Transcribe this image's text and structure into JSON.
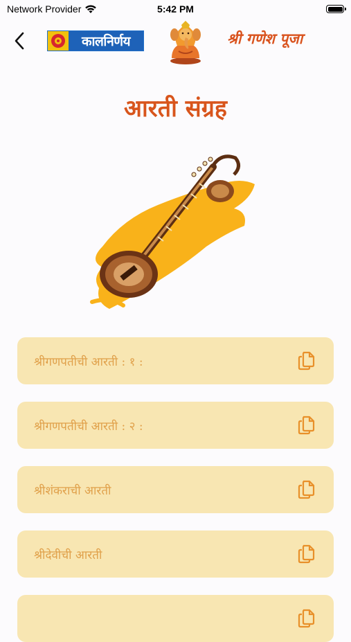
{
  "status_bar": {
    "carrier": "Network Provider",
    "time": "5:42 PM"
  },
  "header": {
    "logo_text": "कालनिर्णय",
    "page_name": "श्री गणेश पूजा"
  },
  "main": {
    "title": "आरती संग्रह",
    "items": [
      {
        "label": "श्रीगणपतीची आरती : १ :"
      },
      {
        "label": "श्रीगणपतीची आरती : २ :"
      },
      {
        "label": "श्रीशंकराची आरती"
      },
      {
        "label": "श्रीदेवीची आरती"
      },
      {
        "label": ""
      }
    ]
  },
  "icons": {
    "back": "chevron-left-icon",
    "copy": "copy-icon",
    "wifi": "wifi-icon",
    "battery": "battery-icon"
  },
  "colors": {
    "accent": "#D8551C",
    "card_bg": "#F8E6B2",
    "card_text": "#E0A04A",
    "copy_icon": "#E8902A",
    "background": "#FCFBFD"
  }
}
